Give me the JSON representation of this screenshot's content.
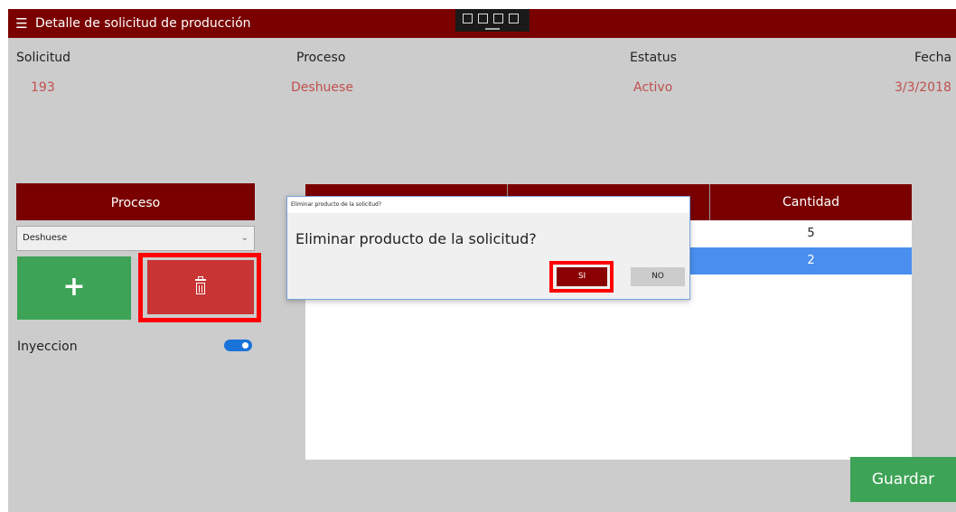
{
  "app": {
    "title": "Detalle de solicitud de producción",
    "menu_icon": "hamburger-icon",
    "colors": {
      "brand": "#7a0000",
      "accent_text": "#c0504d",
      "green": "#3da356",
      "delete": "#c93434",
      "selected_row": "#4a8ff0"
    }
  },
  "summary": {
    "solicitud_label": "Solicitud",
    "solicitud_value": "193",
    "proceso_label": "Proceso",
    "proceso_value": "Deshuese",
    "estatus_label": "Estatus",
    "estatus_value": "Activo",
    "fecha_label": "Fecha",
    "fecha_value": "3/3/2018"
  },
  "left_panel": {
    "proceso_header": "Proceso",
    "proceso_selected": "Deshuese",
    "add_label": "+",
    "inyeccion_label": "Inyeccion",
    "inyeccion_on": true
  },
  "table": {
    "columns": [
      "",
      "",
      "Cantidad"
    ],
    "rows": [
      {
        "cantidad": "5",
        "selected": false
      },
      {
        "cantidad": "2",
        "selected": true
      }
    ]
  },
  "dialog": {
    "title": "Eliminar producto de la solicitud?",
    "message": "Eliminar producto de la solicitud?",
    "yes_label": "SI",
    "no_label": "NO"
  },
  "footer": {
    "save_label": "Guardar"
  }
}
